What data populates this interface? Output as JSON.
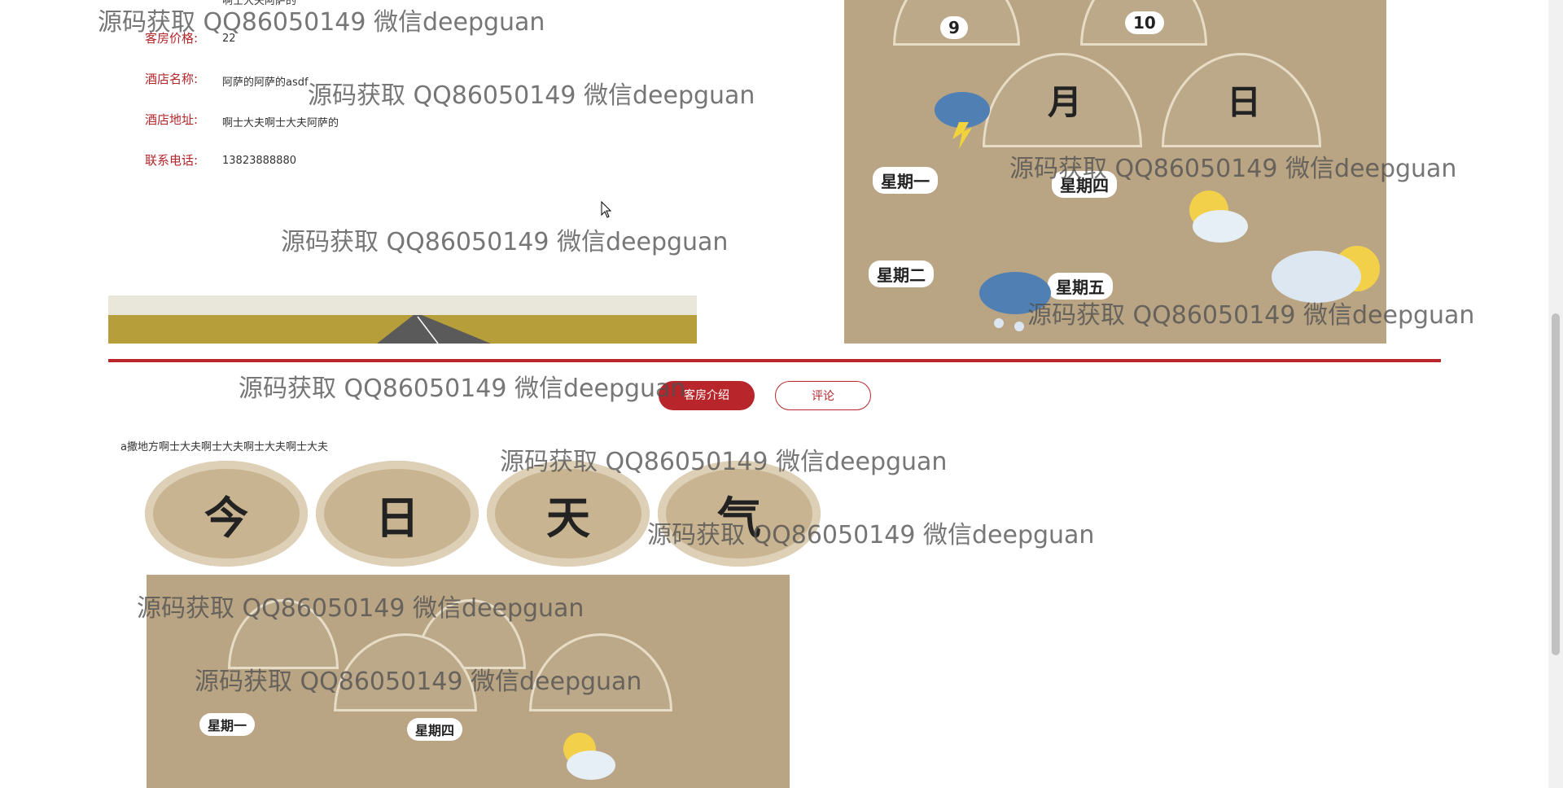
{
  "details": {
    "top_partial_value": "啊士大夫阿萨的",
    "price_label": "客房价格:",
    "price_value": "22",
    "hotel_name_label": "酒店名称:",
    "hotel_name_value": "阿萨的阿萨的asdf",
    "address_label": "酒店地址:",
    "address_value": "啊士大夫啊士大夫阿萨的",
    "phone_label": "联系电话:",
    "phone_value": "13823888880"
  },
  "tabs": {
    "intro_label": "客房介绍",
    "comment_label": "评论"
  },
  "description": "a撒地方啊士大夫啊士大夫啊士大夫啊士大夫",
  "photo_text": {
    "badges": [
      "今",
      "日",
      "天",
      "气"
    ],
    "month": "月",
    "day": "日",
    "digit_a": "9",
    "digit_b": "10",
    "weekday_1": "星期一",
    "weekday_2": "星期二",
    "weekday_4": "星期四",
    "weekday_5": "星期五"
  },
  "watermark": "源码获取 QQ86050149 微信deepguan",
  "colors": {
    "accent": "#b8262b",
    "label": "#b3262a"
  },
  "icons": {
    "cursor": "mouse-pointer-icon"
  }
}
